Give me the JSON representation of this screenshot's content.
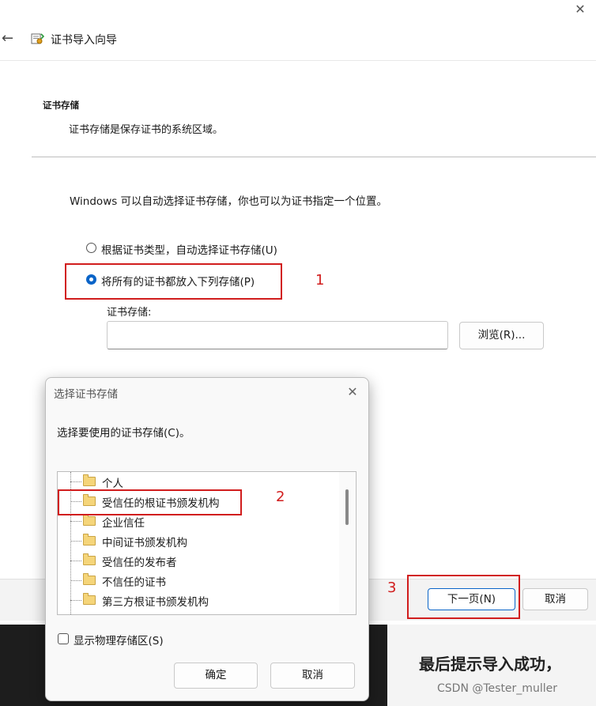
{
  "wizard": {
    "title": "证书导入向导",
    "close_glyph": "✕",
    "back_glyph": "←",
    "section_title": "证书存储",
    "section_desc": "证书存储是保存证书的系统区域。",
    "intro": "Windows 可以自动选择证书存储，你也可以为证书指定一个位置。",
    "radio_auto_label": "根据证书类型，自动选择证书存储(U)",
    "radio_place_label": "将所有的证书都放入下列存储(P)",
    "radio_selected": "place",
    "store_label": "证书存储:",
    "store_value": "",
    "browse_label": "浏览(R)...",
    "next_label": "下一页(N)",
    "cancel_label": "取消"
  },
  "dialog": {
    "title": "选择证书存储",
    "close_glyph": "✕",
    "prompt": "选择要使用的证书存储(C)。",
    "stores": [
      "个人",
      "受信任的根证书颁发机构",
      "企业信任",
      "中间证书颁发机构",
      "受信任的发布者",
      "不信任的证书",
      "第三方根证书颁发机构"
    ],
    "show_physical_label": "显示物理存储区(S)",
    "show_physical_checked": false,
    "ok_label": "确定",
    "cancel_label": "取消"
  },
  "background": {
    "headline": "最后提示导入成功，",
    "watermark": "CSDN @Tester_muller"
  },
  "annotations": [
    "1",
    "2",
    "3"
  ],
  "colors": {
    "accent": "#0a64c8",
    "annotation": "#d11d1d"
  },
  "icons": {
    "wizard": "certificate-icon",
    "folder": "folder-icon"
  }
}
